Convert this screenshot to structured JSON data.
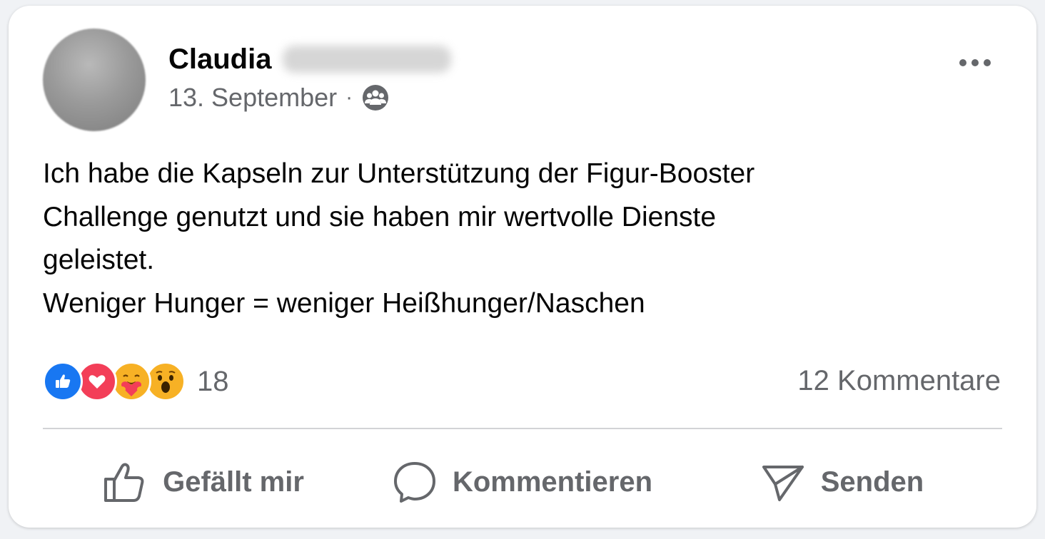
{
  "post": {
    "author_name": "Claudia",
    "date": "13. September",
    "separator": "·",
    "audience_icon": "group-icon",
    "text_lines": [
      "Ich habe die Kapseln zur Unterstützung der Figur-Booster",
      "Challenge genutzt und sie haben mir wertvolle Dienste",
      "geleistet.",
      "Weniger Hunger = weniger Heißhunger/Naschen"
    ]
  },
  "reactions": {
    "icons": [
      "like-reaction-icon",
      "love-reaction-icon",
      "care-reaction-icon",
      "wow-reaction-icon"
    ],
    "count": "18"
  },
  "comments": {
    "label": "12 Kommentare"
  },
  "actions": {
    "like_label": "Gefällt mir",
    "comment_label": "Kommentieren",
    "send_label": "Senden"
  },
  "colors": {
    "like_blue": "#1877f2",
    "love_red": "#f33e58",
    "emoji_yellow": "#f7b125",
    "secondary_text": "#65676b"
  }
}
